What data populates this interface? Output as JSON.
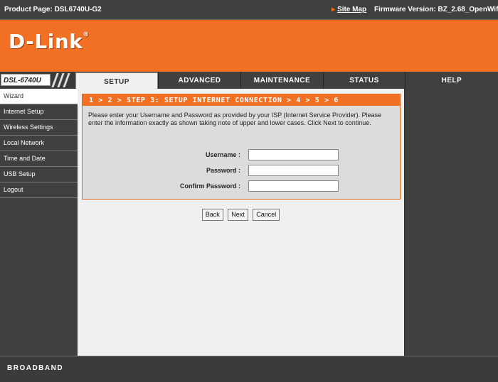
{
  "topbar": {
    "product_page": "Product Page: DSL6740U-G2",
    "site_map": "Site Map",
    "firmware": "Firmware Version: BZ_2.68_OpenWifi"
  },
  "banner": {
    "logo_text": "D-Link",
    "logo_mark": "®"
  },
  "model": "DSL-6740U",
  "tabs": [
    {
      "label": "SETUP",
      "active": true
    },
    {
      "label": "ADVANCED",
      "active": false
    },
    {
      "label": "MAINTENANCE",
      "active": false
    },
    {
      "label": "STATUS",
      "active": false
    },
    {
      "label": "HELP",
      "active": false
    }
  ],
  "sidebar": {
    "items": [
      {
        "label": "Wizard",
        "active": true
      },
      {
        "label": "Internet Setup",
        "active": false
      },
      {
        "label": "Wireless Settings",
        "active": false
      },
      {
        "label": "Local Network",
        "active": false
      },
      {
        "label": "Time and Date",
        "active": false
      },
      {
        "label": "USB Setup",
        "active": false
      },
      {
        "label": "Logout",
        "active": false
      }
    ]
  },
  "panel": {
    "title": "1 > 2 > STEP 3: SETUP INTERNET CONNECTION > 4 > 5 > 6",
    "text": "Please enter your Username and Password as provided by your ISP (Internet Service Provider). Please enter the information exactly as shown taking note of upper and lower cases. Click Next to continue.",
    "fields": [
      {
        "label": "Username :",
        "value": ""
      },
      {
        "label": "Password :",
        "value": ""
      },
      {
        "label": "Confirm Password :",
        "value": ""
      }
    ]
  },
  "buttons": {
    "back": "Back",
    "next": "Next",
    "cancel": "Cancel"
  },
  "footer": {
    "brand": "BROADBAND"
  },
  "colors": {
    "accent": "#f27023",
    "dark": "#404040",
    "content_bg": "#f0f0f0",
    "panel_bg": "#dcdcdc"
  }
}
